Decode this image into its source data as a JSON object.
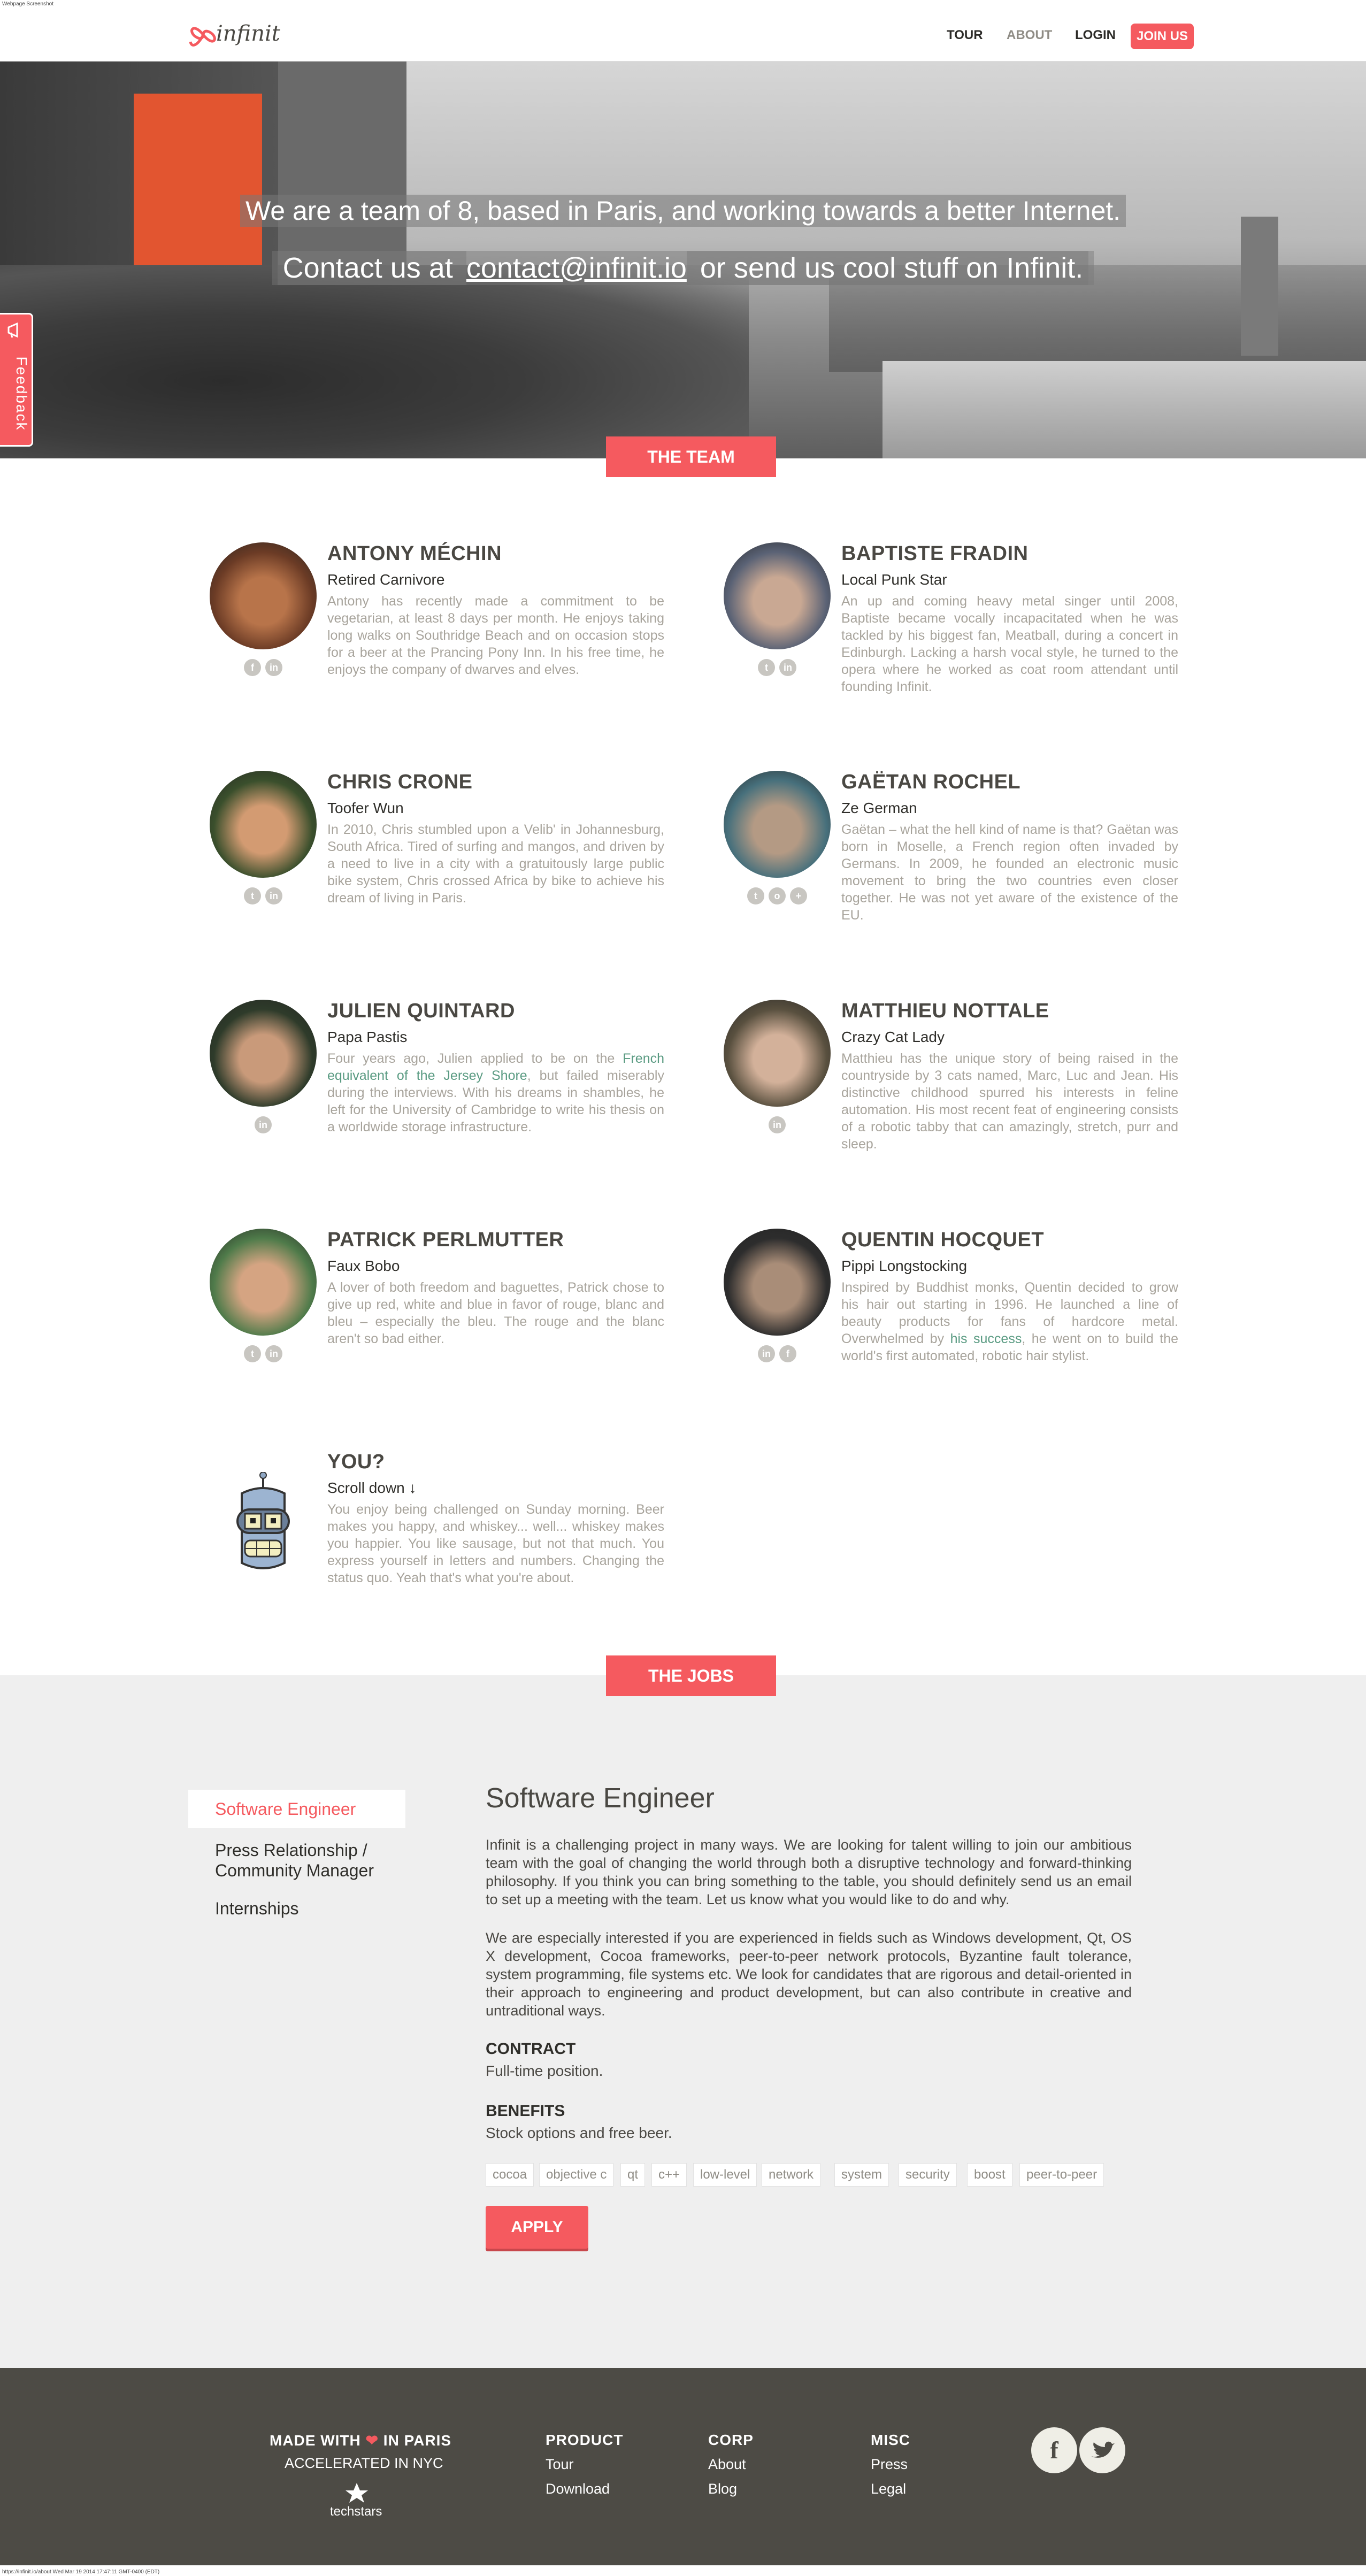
{
  "screenshot_label": "Webpage Screenshot",
  "status_bar": "https://infinit.io/about Wed Mar 19 2014 17:47:11 GMT-0400 (EDT)",
  "nav": {
    "logo_text": "infinit",
    "links": [
      "TOUR",
      "ABOUT",
      "LOGIN"
    ],
    "join": "JOIN US"
  },
  "hero": {
    "line1": "We are a team of 8, based in Paris, and working towards a better Internet.",
    "line2_pre": "Contact us at ",
    "line2_email": "contact@infinit.io",
    "line2_post": " or send us cool stuff on Infinit."
  },
  "feedback": "Feedback",
  "team": {
    "heading": "THE TEAM",
    "members": [
      {
        "name": "ANTONY MÉCHIN",
        "role": "Retired Carnivore",
        "bio": "Antony has recently made a commitment to be vegetarian, at least 8 days per month. He enjoys taking long walks on Southridge Beach and on occasion stops for a beer at the Prancing Pony Inn. In his free time, he enjoys the company of dwarves and elves.",
        "social": [
          "f",
          "in"
        ]
      },
      {
        "name": "BAPTISTE FRADIN",
        "role": "Local Punk Star",
        "bio": "An up and coming heavy metal singer until 2008, Baptiste became vocally incapacitated when he was tackled by his biggest fan, Meatball, during a concert in Edinburgh. Lacking a harsh vocal style, he turned to the opera where he worked as coat room attendant until founding Infinit.",
        "social": [
          "t",
          "in"
        ]
      },
      {
        "name": "CHRIS CRONE",
        "role": "Toofer Wun",
        "bio": "In 2010, Chris stumbled upon a Velib' in Johannesburg, South Africa. Tired of surfing and mangos, and driven by a need to live in a city with a gratuitously large public bike system, Chris crossed Africa by bike to achieve his dream of living in Paris.",
        "social": [
          "t",
          "in"
        ]
      },
      {
        "name": "GAËTAN ROCHEL",
        "role": "Ze German",
        "bio": "Gaëtan – what the hell kind of name is that? Gaëtan was born in Moselle, a French region often invaded by Germans. In 2009, he founded an electronic music movement to bring the two countries even closer together. He was not yet aware of the existence of the EU.",
        "social": [
          "t",
          "o",
          "+"
        ]
      },
      {
        "name": "JULIEN QUINTARD",
        "role": "Papa Pastis",
        "bio_pre": "Four years ago, Julien applied to be on the ",
        "bio_link": "French equivalent of the Jersey Shore",
        "bio_post": ", but failed miserably during the interviews. With his dreams in shambles, he left for the University of Cambridge to write his thesis on a worldwide storage infrastructure.",
        "social": [
          "in"
        ]
      },
      {
        "name": "MATTHIEU NOTTALE",
        "role": "Crazy Cat Lady",
        "bio": "Matthieu has the unique story of being raised in the countryside by 3 cats named, Marc, Luc and Jean. His distinctive childhood spurred his interests in feline automation. His most recent feat of engineering consists of a robotic tabby that can amazingly, stretch, purr and sleep.",
        "social": [
          "in"
        ]
      },
      {
        "name": "PATRICK PERLMUTTER",
        "role": "Faux Bobo",
        "bio": "A lover of both freedom and baguettes, Patrick chose to give up red, white and blue in favor of rouge, blanc and bleu – especially the bleu. The rouge and the blanc aren't so bad either.",
        "social": [
          "t",
          "in"
        ]
      },
      {
        "name": "QUENTIN HOCQUET",
        "role": "Pippi Longstocking",
        "bio_pre": "Inspired by Buddhist monks, Quentin decided to grow his hair out starting in 1996. He launched a line of beauty products for fans of hardcore metal. Overwhelmed by ",
        "bio_link": "his success",
        "bio_post": ", he went on to build the world's first automated, robotic hair stylist.",
        "social": [
          "in",
          "f"
        ]
      },
      {
        "name": "YOU?",
        "role": "Scroll down ↓",
        "bio": "You enjoy being challenged on Sunday morning. Beer makes you happy, and whiskey... well... whiskey makes you happier. You like sausage, but not that much. You express yourself in letters and numbers. Changing the status quo. Yeah that's what you're about.",
        "social": []
      }
    ]
  },
  "jobs": {
    "heading": "THE JOBS",
    "sidebar": [
      "Software Engineer",
      "Press Relationship / Community Manager",
      "Internships"
    ],
    "title": "Software Engineer",
    "p1": "Infinit is a challenging project in many ways. We are looking for talent willing to join our ambitious team with the goal of changing the world through both a disruptive technology and forward-thinking philosophy. If you think you can bring something to the table, you should definitely send us an email to set up a meeting with the team. Let us know what you would like to do and why.",
    "p2": "We are especially interested if you are experienced in fields such as Windows development, Qt, OS X development, Cocoa frameworks, peer-to-peer network protocols, Byzantine fault tolerance, system programming, file systems etc. We look for candidates that are rigorous and detail-oriented in their approach to engineering and product development, but can also contribute in creative and untraditional ways.",
    "contract_h": "CONTRACT",
    "contract": "Full-time position.",
    "benefits_h": "BENEFITS",
    "benefits": "Stock options and free beer.",
    "tags": [
      "cocoa",
      "objective c",
      "qt",
      "c++",
      "low-level",
      "network",
      "system",
      "security",
      "boost",
      "peer-to-peer"
    ],
    "apply": "APPLY"
  },
  "footer": {
    "made_pre": "MADE WITH",
    "made_post": "IN PARIS",
    "accelerated": "ACCELERATED IN NYC",
    "techstars": "techstars",
    "cols": [
      {
        "title": "PRODUCT",
        "links": [
          "Tour",
          "Download"
        ]
      },
      {
        "title": "CORP",
        "links": [
          "About",
          "Blog"
        ]
      },
      {
        "title": "MISC",
        "links": [
          "Press",
          "Legal"
        ]
      }
    ]
  },
  "colors": {
    "accent": "#f55a5f",
    "footer_bg": "#4d4b45",
    "jobs_bg": "#efefef"
  }
}
